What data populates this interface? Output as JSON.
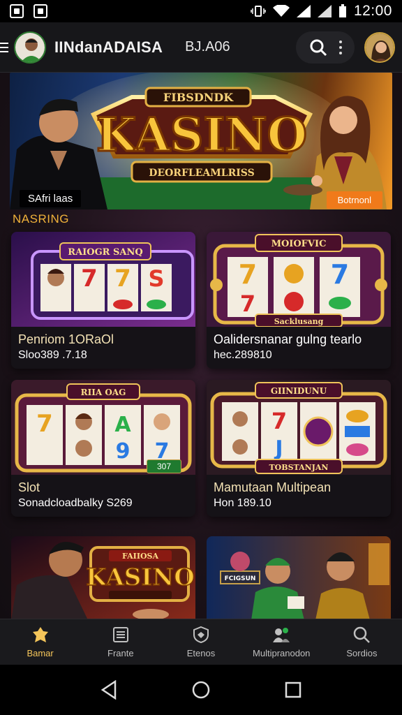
{
  "status_bar": {
    "time": "12:00"
  },
  "app_bar": {
    "title": "IINdanADAISA",
    "subtitle": "BJ.A06",
    "icons": [
      "menu-icon",
      "search-icon",
      "more-vertical-icon"
    ]
  },
  "hero": {
    "badge_top": "FIBSDNDK",
    "logo": "KASINO",
    "ribbon": "DEORFLEAMLRISS",
    "left_label": "SAfri laas",
    "right_button": "Botrnonl"
  },
  "section": {
    "title": "NASRING"
  },
  "cards": [
    {
      "banner": "RAIOGR SANQ",
      "title": "Penriom 1ORaOl",
      "subtitle": "Sloo389 .7.18",
      "badge": ""
    },
    {
      "banner": "MOIOFVIC",
      "title": "Oalidersnanar gulng tearlo",
      "subtitle": "hec.289810",
      "badge": "Sacklusang"
    },
    {
      "banner": "RIIA OAG",
      "title": "Slot",
      "subtitle": "Sonadcloadbalky S269",
      "badge": "307"
    },
    {
      "banner": "GIINIDUNU",
      "title": "Mamutaan Multipean",
      "subtitle": "Hon 189.10",
      "badge": "TOBSTANJAN"
    }
  ],
  "promo_cards": [
    {
      "logo": "KASINO",
      "banner": "FAIIOSA"
    },
    {
      "sign": "FCIGSUN"
    }
  ],
  "bottom_nav": [
    {
      "label": "Bamar",
      "icon": "home-icon",
      "active": true
    },
    {
      "label": "Frante",
      "icon": "list-icon",
      "active": false
    },
    {
      "label": "Etenos",
      "icon": "shield-icon",
      "active": false
    },
    {
      "label": "Multipranodon",
      "icon": "users-icon",
      "active": false
    },
    {
      "label": "Sordios",
      "icon": "search-icon",
      "active": false
    }
  ],
  "colors": {
    "accent": "#f4c55a",
    "section_title": "#f0b23a",
    "hero_button": "#f07a1a"
  }
}
